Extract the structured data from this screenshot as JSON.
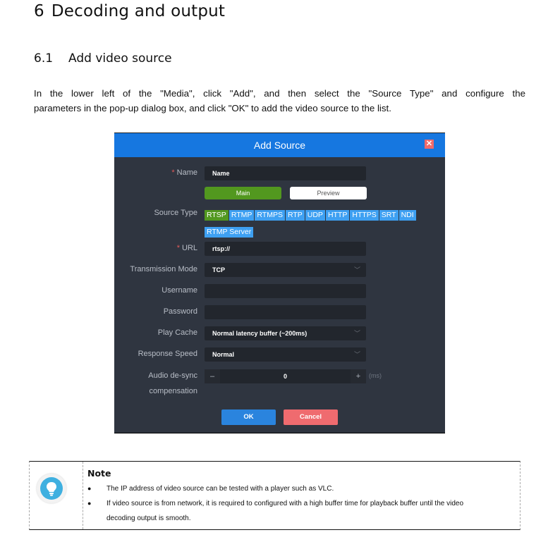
{
  "document": {
    "heading1": {
      "number": "6",
      "title": "Decoding and output"
    },
    "heading2": {
      "number": "6.1",
      "title": "Add video source"
    },
    "paragraph": {
      "line1": "In the lower left of the \"Media\", click \"Add\", and then select the \"Source Type\" and configure the",
      "line2": "parameters in the pop-up dialog box, and click \"OK\" to add the video source to the list."
    }
  },
  "dialog": {
    "title": "Add Source",
    "close_icon": "close-icon",
    "fields": {
      "name": {
        "label": "Name",
        "required": "*",
        "value": "Name"
      },
      "stream_toggle": {
        "main": "Main",
        "preview": "Preview",
        "selected": "Main"
      },
      "source_type": {
        "label": "Source Type",
        "options": [
          "RTSP",
          "RTMP",
          "RTMPS",
          "RTP",
          "UDP",
          "HTTP",
          "HTTPS",
          "SRT",
          "NDI",
          "RTMP Server"
        ],
        "selected": "RTSP"
      },
      "url": {
        "label": "URL",
        "required": "*",
        "value": "rtsp://"
      },
      "transmission_mode": {
        "label": "Transmission Mode",
        "value": "TCP"
      },
      "username": {
        "label": "Username",
        "value": ""
      },
      "password": {
        "label": "Password",
        "value": ""
      },
      "play_cache": {
        "label": "Play Cache",
        "value": "Normal latency buffer (~200ms)"
      },
      "response_speed": {
        "label": "Response Speed",
        "value": "Normal"
      },
      "audio_desync": {
        "label_line1": "Audio de-sync",
        "label_line2": "compensation",
        "value": "0",
        "minus": "–",
        "plus": "+",
        "unit": "(ms)"
      }
    },
    "buttons": {
      "ok": "OK",
      "cancel": "Cancel"
    },
    "colors": {
      "header": "#1677e0",
      "body": "#2f3540",
      "active": "#52981f",
      "chip": "#3ea0f2",
      "cancel": "#ef6b6f"
    }
  },
  "note": {
    "icon": "lightbulb-icon",
    "title": "Note",
    "items": [
      {
        "bullet": "●",
        "text": "The IP address of video source can be tested with a player such as VLC."
      },
      {
        "bullet": "●",
        "text": "If video source is from network, it is required to configured with a high buffer time for playback buffer until the video",
        "cont": "decoding output is smooth."
      }
    ]
  }
}
